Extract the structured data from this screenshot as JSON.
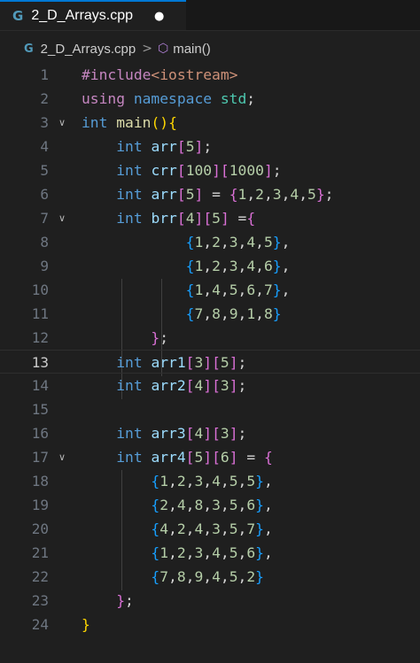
{
  "tab": {
    "icon": "cpp-file-icon",
    "icon_glyph": "G",
    "label": "2_D_Arrays.cpp",
    "dirty_indicator": "●"
  },
  "breadcrumb": {
    "file_icon_glyph": "G",
    "file": "2_D_Arrays.cpp",
    "separator": ">",
    "symbol_icon": "cube-icon",
    "symbol_icon_glyph": "⬡",
    "symbol": "main()"
  },
  "editor": {
    "current_line": 13,
    "folded_lines": [
      3,
      7,
      17
    ],
    "lines": [
      {
        "n": "1",
        "tokens": [
          [
            "kw-purple",
            "#include"
          ],
          [
            "str",
            "<iostream>"
          ]
        ]
      },
      {
        "n": "2",
        "tokens": [
          [
            "kw-purple",
            "using"
          ],
          [
            "pl",
            " "
          ],
          [
            "kw-blue",
            "namespace"
          ],
          [
            "pl",
            " "
          ],
          [
            "ty",
            "std"
          ],
          [
            "pl",
            ";"
          ]
        ]
      },
      {
        "n": "3",
        "tokens": [
          [
            "kw-blue",
            "int"
          ],
          [
            "pl",
            " "
          ],
          [
            "fn",
            "main"
          ],
          [
            "p1",
            "()"
          ],
          [
            "p1",
            "{"
          ]
        ]
      },
      {
        "n": "4",
        "tokens": [
          [
            "pl",
            "    "
          ],
          [
            "kw-blue",
            "int"
          ],
          [
            "pl",
            " "
          ],
          [
            "var",
            "arr"
          ],
          [
            "p2",
            "["
          ],
          [
            "num",
            "5"
          ],
          [
            "p2",
            "]"
          ],
          [
            "pl",
            ";"
          ]
        ]
      },
      {
        "n": "5",
        "tokens": [
          [
            "pl",
            "    "
          ],
          [
            "kw-blue",
            "int"
          ],
          [
            "pl",
            " "
          ],
          [
            "var",
            "crr"
          ],
          [
            "p2",
            "["
          ],
          [
            "num",
            "100"
          ],
          [
            "p2",
            "]"
          ],
          [
            "p2",
            "["
          ],
          [
            "num",
            "1000"
          ],
          [
            "p2",
            "]"
          ],
          [
            "pl",
            ";"
          ]
        ]
      },
      {
        "n": "6",
        "tokens": [
          [
            "pl",
            "    "
          ],
          [
            "kw-blue",
            "int"
          ],
          [
            "pl",
            " "
          ],
          [
            "var",
            "arr"
          ],
          [
            "p2",
            "["
          ],
          [
            "num",
            "5"
          ],
          [
            "p2",
            "]"
          ],
          [
            "pl",
            " = "
          ],
          [
            "p2",
            "{"
          ],
          [
            "num",
            "1"
          ],
          [
            "pl",
            ","
          ],
          [
            "num",
            "2"
          ],
          [
            "pl",
            ","
          ],
          [
            "num",
            "3"
          ],
          [
            "pl",
            ","
          ],
          [
            "num",
            "4"
          ],
          [
            "pl",
            ","
          ],
          [
            "num",
            "5"
          ],
          [
            "p2",
            "}"
          ],
          [
            "pl",
            ";"
          ]
        ]
      },
      {
        "n": "7",
        "tokens": [
          [
            "pl",
            "    "
          ],
          [
            "kw-blue",
            "int"
          ],
          [
            "pl",
            " "
          ],
          [
            "var",
            "brr"
          ],
          [
            "p2",
            "["
          ],
          [
            "num",
            "4"
          ],
          [
            "p2",
            "]"
          ],
          [
            "p2",
            "["
          ],
          [
            "num",
            "5"
          ],
          [
            "p2",
            "]"
          ],
          [
            "pl",
            " ="
          ],
          [
            "p2",
            "{"
          ]
        ]
      },
      {
        "n": "8",
        "tokens": [
          [
            "pl",
            "            "
          ],
          [
            "p3",
            "{"
          ],
          [
            "num",
            "1"
          ],
          [
            "pl",
            ","
          ],
          [
            "num",
            "2"
          ],
          [
            "pl",
            ","
          ],
          [
            "num",
            "3"
          ],
          [
            "pl",
            ","
          ],
          [
            "num",
            "4"
          ],
          [
            "pl",
            ","
          ],
          [
            "num",
            "5"
          ],
          [
            "p3",
            "}"
          ],
          [
            "pl",
            ","
          ]
        ]
      },
      {
        "n": "9",
        "tokens": [
          [
            "pl",
            "            "
          ],
          [
            "p3",
            "{"
          ],
          [
            "num",
            "1"
          ],
          [
            "pl",
            ","
          ],
          [
            "num",
            "2"
          ],
          [
            "pl",
            ","
          ],
          [
            "num",
            "3"
          ],
          [
            "pl",
            ","
          ],
          [
            "num",
            "4"
          ],
          [
            "pl",
            ","
          ],
          [
            "num",
            "6"
          ],
          [
            "p3",
            "}"
          ],
          [
            "pl",
            ","
          ]
        ]
      },
      {
        "n": "10",
        "tokens": [
          [
            "pl",
            "            "
          ],
          [
            "p3",
            "{"
          ],
          [
            "num",
            "1"
          ],
          [
            "pl",
            ","
          ],
          [
            "num",
            "4"
          ],
          [
            "pl",
            ","
          ],
          [
            "num",
            "5"
          ],
          [
            "pl",
            ","
          ],
          [
            "num",
            "6"
          ],
          [
            "pl",
            ","
          ],
          [
            "num",
            "7"
          ],
          [
            "p3",
            "}"
          ],
          [
            "pl",
            ","
          ]
        ]
      },
      {
        "n": "11",
        "tokens": [
          [
            "pl",
            "            "
          ],
          [
            "p3",
            "{"
          ],
          [
            "num",
            "7"
          ],
          [
            "pl",
            ","
          ],
          [
            "num",
            "8"
          ],
          [
            "pl",
            ","
          ],
          [
            "num",
            "9"
          ],
          [
            "pl",
            ","
          ],
          [
            "num",
            "1"
          ],
          [
            "pl",
            ","
          ],
          [
            "num",
            "8"
          ],
          [
            "p3",
            "}"
          ]
        ]
      },
      {
        "n": "12",
        "tokens": [
          [
            "pl",
            "        "
          ],
          [
            "p2",
            "}"
          ],
          [
            "pl",
            ";"
          ]
        ]
      },
      {
        "n": "13",
        "tokens": [
          [
            "pl",
            "    "
          ],
          [
            "kw-blue",
            "int"
          ],
          [
            "pl",
            " "
          ],
          [
            "var",
            "arr1"
          ],
          [
            "p2",
            "["
          ],
          [
            "num",
            "3"
          ],
          [
            "p2",
            "]"
          ],
          [
            "p2",
            "["
          ],
          [
            "num",
            "5"
          ],
          [
            "p2",
            "]"
          ],
          [
            "pl",
            ";"
          ]
        ]
      },
      {
        "n": "14",
        "tokens": [
          [
            "pl",
            "    "
          ],
          [
            "kw-blue",
            "int"
          ],
          [
            "pl",
            " "
          ],
          [
            "var",
            "arr2"
          ],
          [
            "p2",
            "["
          ],
          [
            "num",
            "4"
          ],
          [
            "p2",
            "]"
          ],
          [
            "p2",
            "["
          ],
          [
            "num",
            "3"
          ],
          [
            "p2",
            "]"
          ],
          [
            "pl",
            ";"
          ]
        ]
      },
      {
        "n": "15",
        "tokens": []
      },
      {
        "n": "16",
        "tokens": [
          [
            "pl",
            "    "
          ],
          [
            "kw-blue",
            "int"
          ],
          [
            "pl",
            " "
          ],
          [
            "var",
            "arr3"
          ],
          [
            "p2",
            "["
          ],
          [
            "num",
            "4"
          ],
          [
            "p2",
            "]"
          ],
          [
            "p2",
            "["
          ],
          [
            "num",
            "3"
          ],
          [
            "p2",
            "]"
          ],
          [
            "pl",
            ";"
          ]
        ]
      },
      {
        "n": "17",
        "tokens": [
          [
            "pl",
            "    "
          ],
          [
            "kw-blue",
            "int"
          ],
          [
            "pl",
            " "
          ],
          [
            "var",
            "arr4"
          ],
          [
            "p2",
            "["
          ],
          [
            "num",
            "5"
          ],
          [
            "p2",
            "]"
          ],
          [
            "p2",
            "["
          ],
          [
            "num",
            "6"
          ],
          [
            "p2",
            "]"
          ],
          [
            "pl",
            " = "
          ],
          [
            "p2",
            "{"
          ]
        ]
      },
      {
        "n": "18",
        "tokens": [
          [
            "pl",
            "        "
          ],
          [
            "p3",
            "{"
          ],
          [
            "num",
            "1"
          ],
          [
            "pl",
            ","
          ],
          [
            "num",
            "2"
          ],
          [
            "pl",
            ","
          ],
          [
            "num",
            "3"
          ],
          [
            "pl",
            ","
          ],
          [
            "num",
            "4"
          ],
          [
            "pl",
            ","
          ],
          [
            "num",
            "5"
          ],
          [
            "pl",
            ","
          ],
          [
            "num",
            "5"
          ],
          [
            "p3",
            "}"
          ],
          [
            "pl",
            ","
          ]
        ]
      },
      {
        "n": "19",
        "tokens": [
          [
            "pl",
            "        "
          ],
          [
            "p3",
            "{"
          ],
          [
            "num",
            "2"
          ],
          [
            "pl",
            ","
          ],
          [
            "num",
            "4"
          ],
          [
            "pl",
            ","
          ],
          [
            "num",
            "8"
          ],
          [
            "pl",
            ","
          ],
          [
            "num",
            "3"
          ],
          [
            "pl",
            ","
          ],
          [
            "num",
            "5"
          ],
          [
            "pl",
            ","
          ],
          [
            "num",
            "6"
          ],
          [
            "p3",
            "}"
          ],
          [
            "pl",
            ","
          ]
        ]
      },
      {
        "n": "20",
        "tokens": [
          [
            "pl",
            "        "
          ],
          [
            "p3",
            "{"
          ],
          [
            "num",
            "4"
          ],
          [
            "pl",
            ","
          ],
          [
            "num",
            "2"
          ],
          [
            "pl",
            ","
          ],
          [
            "num",
            "4"
          ],
          [
            "pl",
            ","
          ],
          [
            "num",
            "3"
          ],
          [
            "pl",
            ","
          ],
          [
            "num",
            "5"
          ],
          [
            "pl",
            ","
          ],
          [
            "num",
            "7"
          ],
          [
            "p3",
            "}"
          ],
          [
            "pl",
            ","
          ]
        ]
      },
      {
        "n": "21",
        "tokens": [
          [
            "pl",
            "        "
          ],
          [
            "p3",
            "{"
          ],
          [
            "num",
            "1"
          ],
          [
            "pl",
            ","
          ],
          [
            "num",
            "2"
          ],
          [
            "pl",
            ","
          ],
          [
            "num",
            "3"
          ],
          [
            "pl",
            ","
          ],
          [
            "num",
            "4"
          ],
          [
            "pl",
            ","
          ],
          [
            "num",
            "5"
          ],
          [
            "pl",
            ","
          ],
          [
            "num",
            "6"
          ],
          [
            "p3",
            "}"
          ],
          [
            "pl",
            ","
          ]
        ]
      },
      {
        "n": "22",
        "tokens": [
          [
            "pl",
            "        "
          ],
          [
            "p3",
            "{"
          ],
          [
            "num",
            "7"
          ],
          [
            "pl",
            ","
          ],
          [
            "num",
            "8"
          ],
          [
            "pl",
            ","
          ],
          [
            "num",
            "9"
          ],
          [
            "pl",
            ","
          ],
          [
            "num",
            "4"
          ],
          [
            "pl",
            ","
          ],
          [
            "num",
            "5"
          ],
          [
            "pl",
            ","
          ],
          [
            "num",
            "2"
          ],
          [
            "p3",
            "}"
          ]
        ]
      },
      {
        "n": "23",
        "tokens": [
          [
            "pl",
            "    "
          ],
          [
            "p2",
            "}"
          ],
          [
            "pl",
            ";"
          ]
        ]
      },
      {
        "n": "24",
        "tokens": [
          [
            "p1",
            "}"
          ]
        ]
      }
    ]
  }
}
